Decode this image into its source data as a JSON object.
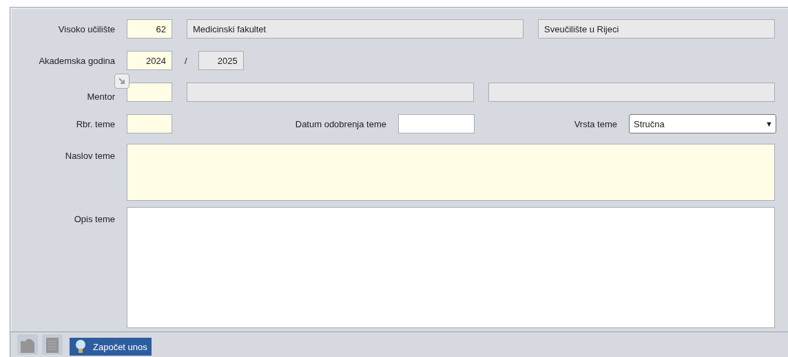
{
  "form": {
    "institution": {
      "label": "Visoko učilište",
      "code": {
        "kind": "required",
        "value": "62"
      },
      "name": {
        "kind": "readonly",
        "value": "Medicinski fakultet"
      },
      "university": {
        "kind": "readonly",
        "value": "Sveučilište u Rijeci"
      }
    },
    "academic_year": {
      "label": "Akademska godina",
      "from": {
        "kind": "required",
        "value": "2024"
      },
      "separator": "/",
      "to": {
        "kind": "readonly",
        "value": "2025"
      }
    },
    "mentor": {
      "label": "Mentor",
      "code": {
        "kind": "required"
      },
      "name": {
        "kind": "readonly"
      },
      "extra": {
        "kind": "readonly"
      }
    },
    "topic_no": {
      "label": "Rbr. teme",
      "field": {
        "kind": "required"
      }
    },
    "approval_date": {
      "label": "Datum odobrenja teme",
      "field": {
        "kind": "editable"
      }
    },
    "topic_type": {
      "label": "Vrsta teme",
      "value": "Stručna",
      "caret": "▼"
    },
    "title": {
      "label": "Naslov teme",
      "field": {
        "kind": "required"
      }
    },
    "description": {
      "label": "Opis teme",
      "field": {
        "kind": "editable"
      }
    }
  },
  "toolbar": {
    "buttons": [
      {
        "kind": "folder",
        "disabled": true
      },
      {
        "kind": "list",
        "disabled": true
      }
    ],
    "start": {
      "label": "Započet unos"
    }
  }
}
